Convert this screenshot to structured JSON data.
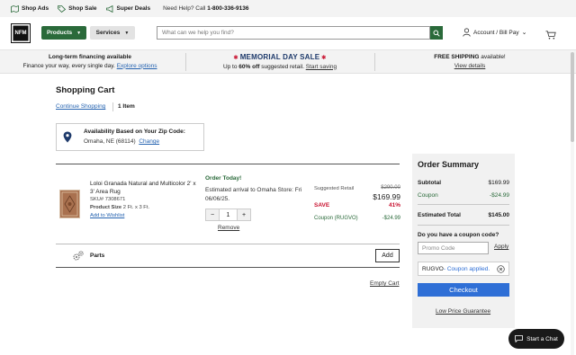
{
  "util_bar": {
    "shop_ads": "Shop Ads",
    "shop_sale": "Shop Sale",
    "super_deals": "Super Deals",
    "help_text": "Need Help? Call ",
    "phone": "1-800-336-9136"
  },
  "header": {
    "logo": "NFM",
    "products": "Products",
    "services": "Services",
    "search_placeholder": "What can we help you find?",
    "account": "Account / Bill Pay"
  },
  "promo": {
    "financing_title": "Long-term financing available",
    "financing_sub": "Finance your way, every single day.",
    "financing_link": "Explore options",
    "sale_title": "MEMORIAL DAY SALE",
    "sale_pre": "Up to ",
    "sale_pct": "60% off",
    "sale_post": " suggested retail.",
    "sale_link": "Start saving",
    "ship_title": "FREE SHIPPING",
    "ship_suffix": " available!",
    "ship_link": "View details"
  },
  "cart": {
    "title": "Shopping Cart",
    "continue": "Continue Shopping",
    "item_count": "1 Item",
    "zip_title": "Availability Based on Your Zip Code:",
    "zip_value": "Omaha, NE (68114)",
    "zip_change": "Change",
    "item": {
      "name": "Loloi Granada Natural and Multicolor 2' x 3' Area Rug",
      "sku_label": "SKU# ",
      "sku": "7308671",
      "size_label": "Product Size",
      "size": " 2 Ft. x 3 Ft.",
      "wishlist": "Add to Wishlist",
      "order_today": "Order Today!",
      "eta": "Estimated arrival to Omaha Store: Fri 06/06/25.",
      "qty": "1",
      "remove": "Remove",
      "suggested_label": "Suggested Retail",
      "suggested_value": "$290.00",
      "price": "$169.99",
      "save_label": "SAVE",
      "save_value": "41%",
      "coupon_label": "Coupon (RUGVO)",
      "coupon_value": "-$24.99"
    },
    "parts_label": "Parts",
    "add": "Add",
    "empty_cart": "Empty Cart"
  },
  "summary": {
    "title": "Order Summary",
    "subtotal_label": "Subtotal",
    "subtotal": "$169.99",
    "coupon_label": "Coupon",
    "coupon": "-$24.99",
    "total_label": "Estimated Total",
    "total": "$145.00",
    "coupon_q": "Do you have a coupon code?",
    "promo_placeholder": "Promo Code",
    "apply": "Apply",
    "applied_code": "RUGVO",
    "applied_text": " - Coupon applied.",
    "checkout": "Checkout",
    "guarantee": "Low Price Guarantee"
  },
  "chat": "Start a Chat",
  "colors": {
    "green": "#2a6a3a",
    "blue": "#2f6fd6",
    "red": "#c8102e",
    "navy": "#1e3a6b"
  }
}
